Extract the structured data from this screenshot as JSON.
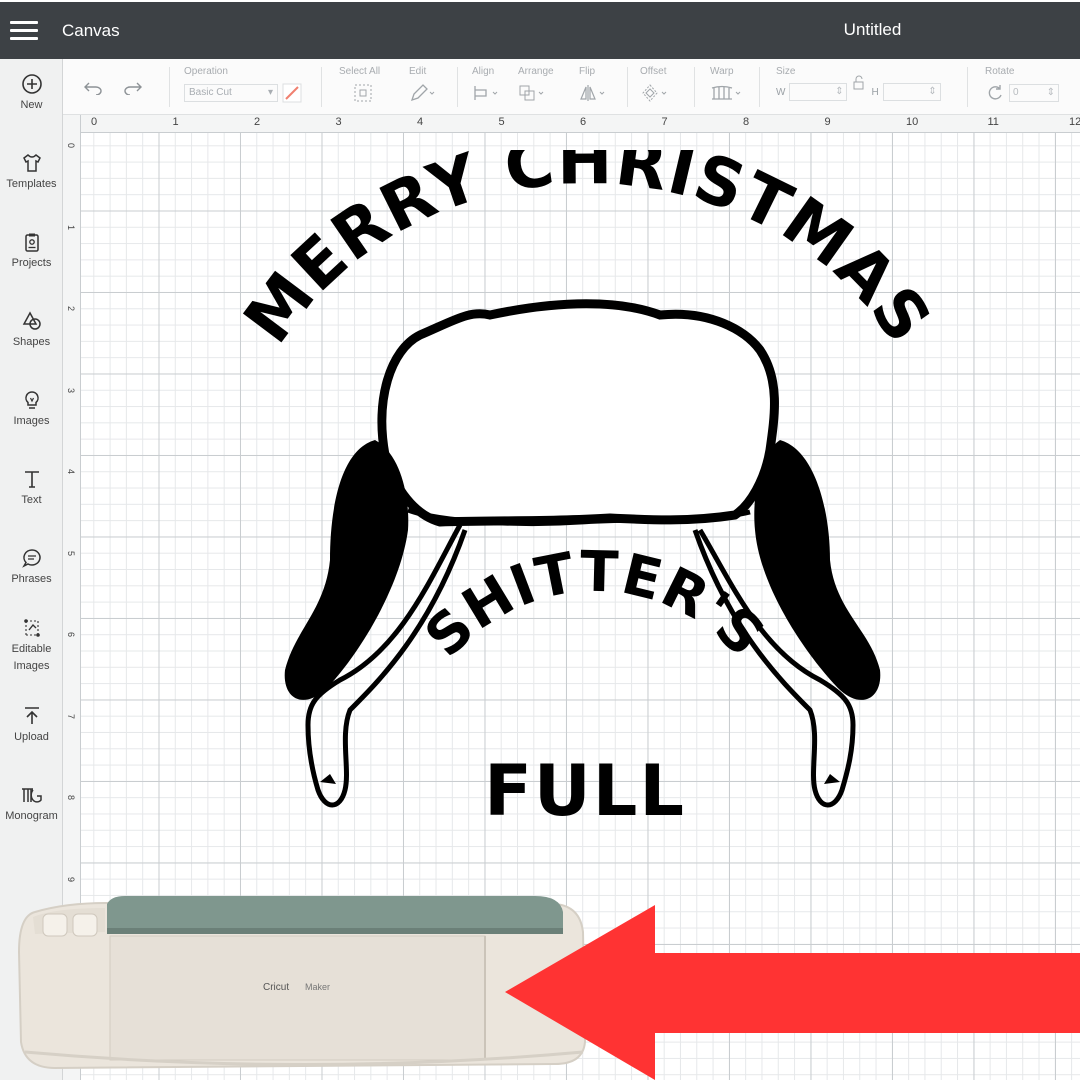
{
  "topbar": {
    "app_title": "Canvas",
    "doc_title": "Untitled"
  },
  "sidebar": {
    "items": [
      {
        "label": "New",
        "icon": "plus-circle-icon"
      },
      {
        "label": "Templates",
        "icon": "shirt-icon"
      },
      {
        "label": "Projects",
        "icon": "clipboard-icon"
      },
      {
        "label": "Shapes",
        "icon": "shapes-icon"
      },
      {
        "label": "Images",
        "icon": "lightbulb-icon"
      },
      {
        "label": "Text",
        "icon": "text-icon"
      },
      {
        "label": "Phrases",
        "icon": "speech-bubble-icon"
      },
      {
        "label": "Editable Images",
        "icon": "editable-image-icon"
      },
      {
        "label": "Upload",
        "icon": "upload-icon"
      },
      {
        "label": "Monogram",
        "icon": "monogram-icon"
      }
    ]
  },
  "toolbar": {
    "operation_label": "Operation",
    "operation_value": "Basic Cut",
    "select_all_label": "Select All",
    "edit_label": "Edit",
    "align_label": "Align",
    "arrange_label": "Arrange",
    "flip_label": "Flip",
    "offset_label": "Offset",
    "warp_label": "Warp",
    "size_label": "Size",
    "width_prefix": "W",
    "height_prefix": "H",
    "rotate_label": "Rotate",
    "rotate_value": "0"
  },
  "ruler": {
    "top_numbers": [
      "0",
      "1",
      "2",
      "3",
      "4",
      "5",
      "6",
      "7",
      "8",
      "9",
      "10",
      "11",
      "12"
    ],
    "left_numbers": [
      "0",
      "1",
      "2",
      "3",
      "4",
      "5",
      "6",
      "7",
      "8",
      "9"
    ]
  },
  "design": {
    "line_top": "MERRY CHRISTMAS",
    "line_mid": "SHITTER'S",
    "line_low": "FULL"
  },
  "machine": {
    "brand": "Cricut",
    "model": "Maker"
  },
  "colors": {
    "topbar": "#3d4145",
    "arrow": "#ff3333",
    "machine_lid": "#7f978e",
    "machine_body": "#e9e3da"
  }
}
